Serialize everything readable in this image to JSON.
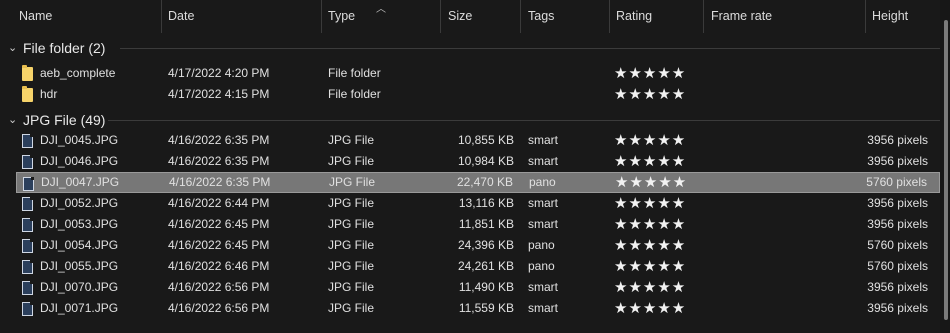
{
  "columns": {
    "name": "Name",
    "date": "Date",
    "type": "Type",
    "size": "Size",
    "tags": "Tags",
    "rating": "Rating",
    "frame_rate": "Frame rate",
    "height": "Height"
  },
  "groups": [
    {
      "title": "File folder (2)",
      "rows": [
        {
          "name": "aeb_complete",
          "date": "4/17/2022 4:20 PM",
          "type": "File folder",
          "size": "",
          "tags": "",
          "rating": "★★★★★",
          "height": ""
        },
        {
          "name": "hdr",
          "date": "4/17/2022 4:15 PM",
          "type": "File folder",
          "size": "",
          "tags": "",
          "rating": "★★★★★",
          "height": ""
        }
      ]
    },
    {
      "title": "JPG File (49)",
      "rows": [
        {
          "name": "DJI_0045.JPG",
          "date": "4/16/2022 6:35 PM",
          "type": "JPG File",
          "size": "10,855 KB",
          "tags": "smart",
          "rating": "★★★★★",
          "height": "3956 pixels"
        },
        {
          "name": "DJI_0046.JPG",
          "date": "4/16/2022 6:35 PM",
          "type": "JPG File",
          "size": "10,984 KB",
          "tags": "smart",
          "rating": "★★★★★",
          "height": "3956 pixels"
        },
        {
          "name": "DJI_0047.JPG",
          "date": "4/16/2022 6:35 PM",
          "type": "JPG File",
          "size": "22,470 KB",
          "tags": "pano",
          "rating": "★★★★★",
          "height": "5760 pixels"
        },
        {
          "name": "DJI_0052.JPG",
          "date": "4/16/2022 6:44 PM",
          "type": "JPG File",
          "size": "13,116 KB",
          "tags": "smart",
          "rating": "★★★★★",
          "height": "3956 pixels"
        },
        {
          "name": "DJI_0053.JPG",
          "date": "4/16/2022 6:45 PM",
          "type": "JPG File",
          "size": "11,851 KB",
          "tags": "smart",
          "rating": "★★★★★",
          "height": "3956 pixels"
        },
        {
          "name": "DJI_0054.JPG",
          "date": "4/16/2022 6:45 PM",
          "type": "JPG File",
          "size": "24,396 KB",
          "tags": "pano",
          "rating": "★★★★★",
          "height": "5760 pixels"
        },
        {
          "name": "DJI_0055.JPG",
          "date": "4/16/2022 6:46 PM",
          "type": "JPG File",
          "size": "24,261 KB",
          "tags": "pano",
          "rating": "★★★★★",
          "height": "5760 pixels"
        },
        {
          "name": "DJI_0070.JPG",
          "date": "4/16/2022 6:56 PM",
          "type": "JPG File",
          "size": "11,490 KB",
          "tags": "smart",
          "rating": "★★★★★",
          "height": "3956 pixels"
        },
        {
          "name": "DJI_0071.JPG",
          "date": "4/16/2022 6:56 PM",
          "type": "JPG File",
          "size": "11,559 KB",
          "tags": "smart",
          "rating": "★★★★★",
          "height": "3956 pixels"
        }
      ]
    }
  ],
  "colors": {
    "background": "#191919",
    "selected_row": "#777777",
    "folder": "#f6d36a"
  },
  "icons": {
    "folder": "folder-icon",
    "file": "jpg-file-icon",
    "sort": "sort-ascending-icon",
    "collapse": "chevron-down-icon"
  }
}
